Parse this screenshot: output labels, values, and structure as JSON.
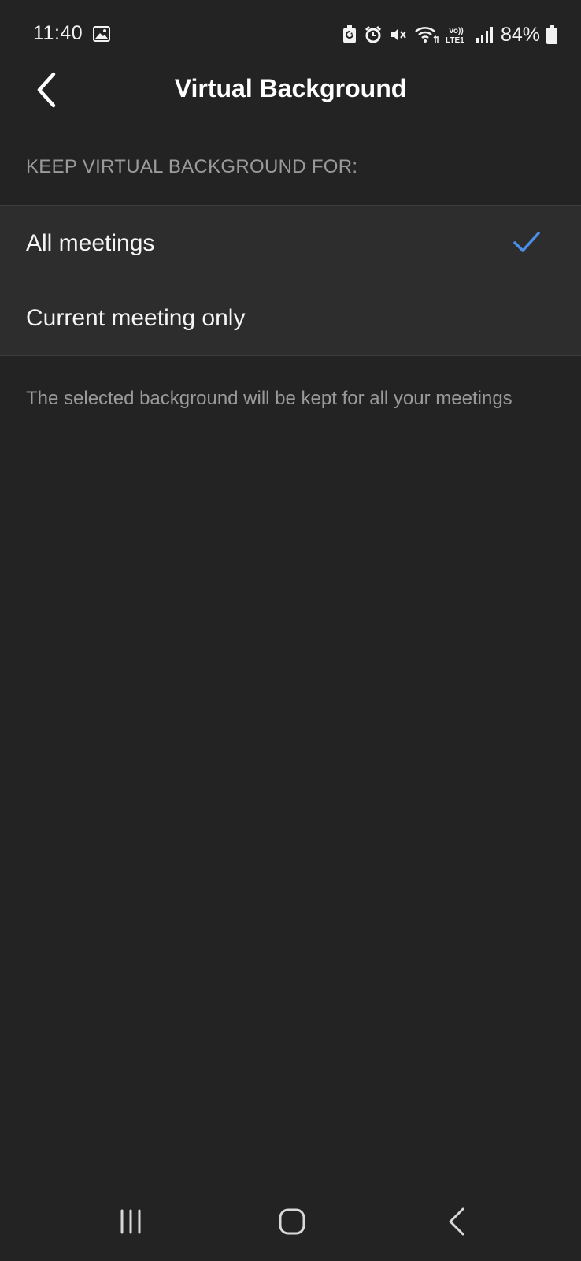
{
  "status_bar": {
    "time": "11:40",
    "battery": "84%",
    "icons": [
      "gallery-icon",
      "battery-saver-icon",
      "alarm-icon",
      "mute-icon",
      "wifi-icon",
      "volte-icon",
      "signal-icon",
      "battery-icon"
    ]
  },
  "header": {
    "title": "Virtual Background",
    "back_icon": "chevron-left-icon"
  },
  "section": {
    "label": "KEEP VIRTUAL BACKGROUND FOR:"
  },
  "options": [
    {
      "label": "All meetings",
      "selected": true
    },
    {
      "label": "Current meeting only",
      "selected": false
    }
  ],
  "description": "The selected background will be kept for all your meetings",
  "colors": {
    "background": "#232323",
    "group_background": "#2d2d2d",
    "accent": "#4a8fe7",
    "secondary_text": "#9a9a9a"
  },
  "nav_bar": {
    "icons": [
      "recents-icon",
      "home-icon",
      "back-icon"
    ]
  }
}
